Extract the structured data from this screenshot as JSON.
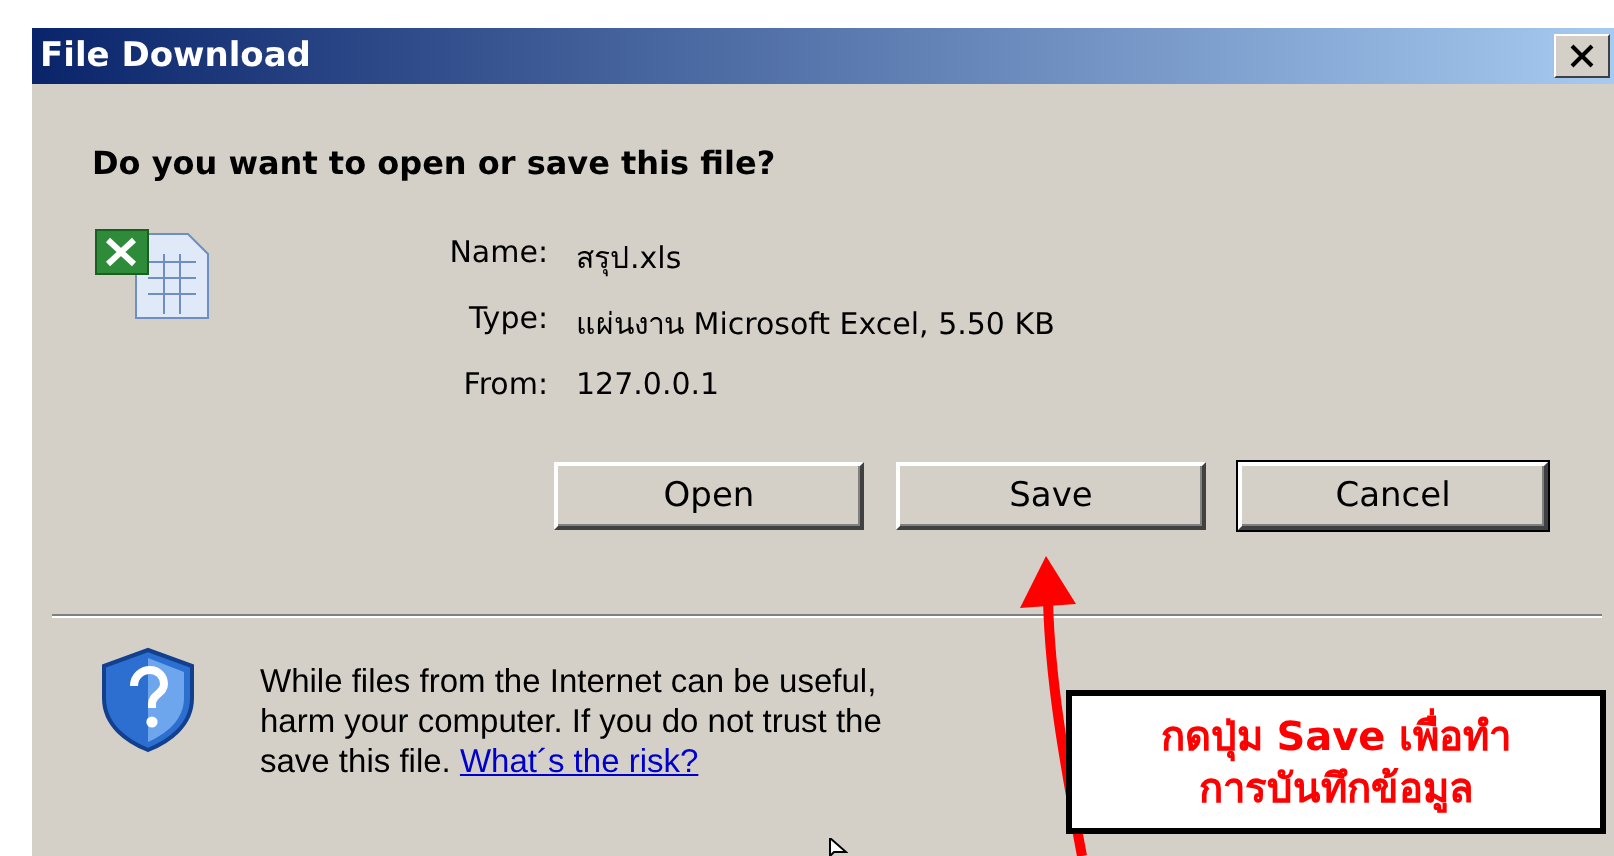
{
  "window": {
    "title": "File Download"
  },
  "question": "Do you want to open or save this file?",
  "details": [
    {
      "label": "Name:",
      "value": "สรุป.xls"
    },
    {
      "label": "Type:",
      "value": "แผ่นงาน Microsoft Excel, 5.50 KB"
    },
    {
      "label": "From:",
      "value": "127.0.0.1"
    }
  ],
  "buttons": [
    {
      "label": "Open",
      "default": false
    },
    {
      "label": "Save",
      "default": false
    },
    {
      "label": "Cancel",
      "default": true
    }
  ],
  "warning": {
    "lines": [
      "While files from the Internet can be useful,",
      "harm your computer. If you do not trust the",
      "save this file."
    ],
    "link": "What´s the risk?"
  },
  "callout": {
    "lines": [
      "กดปุ่ม Save เพื่อทำ",
      "การบันทึกข้อมูล"
    ]
  }
}
